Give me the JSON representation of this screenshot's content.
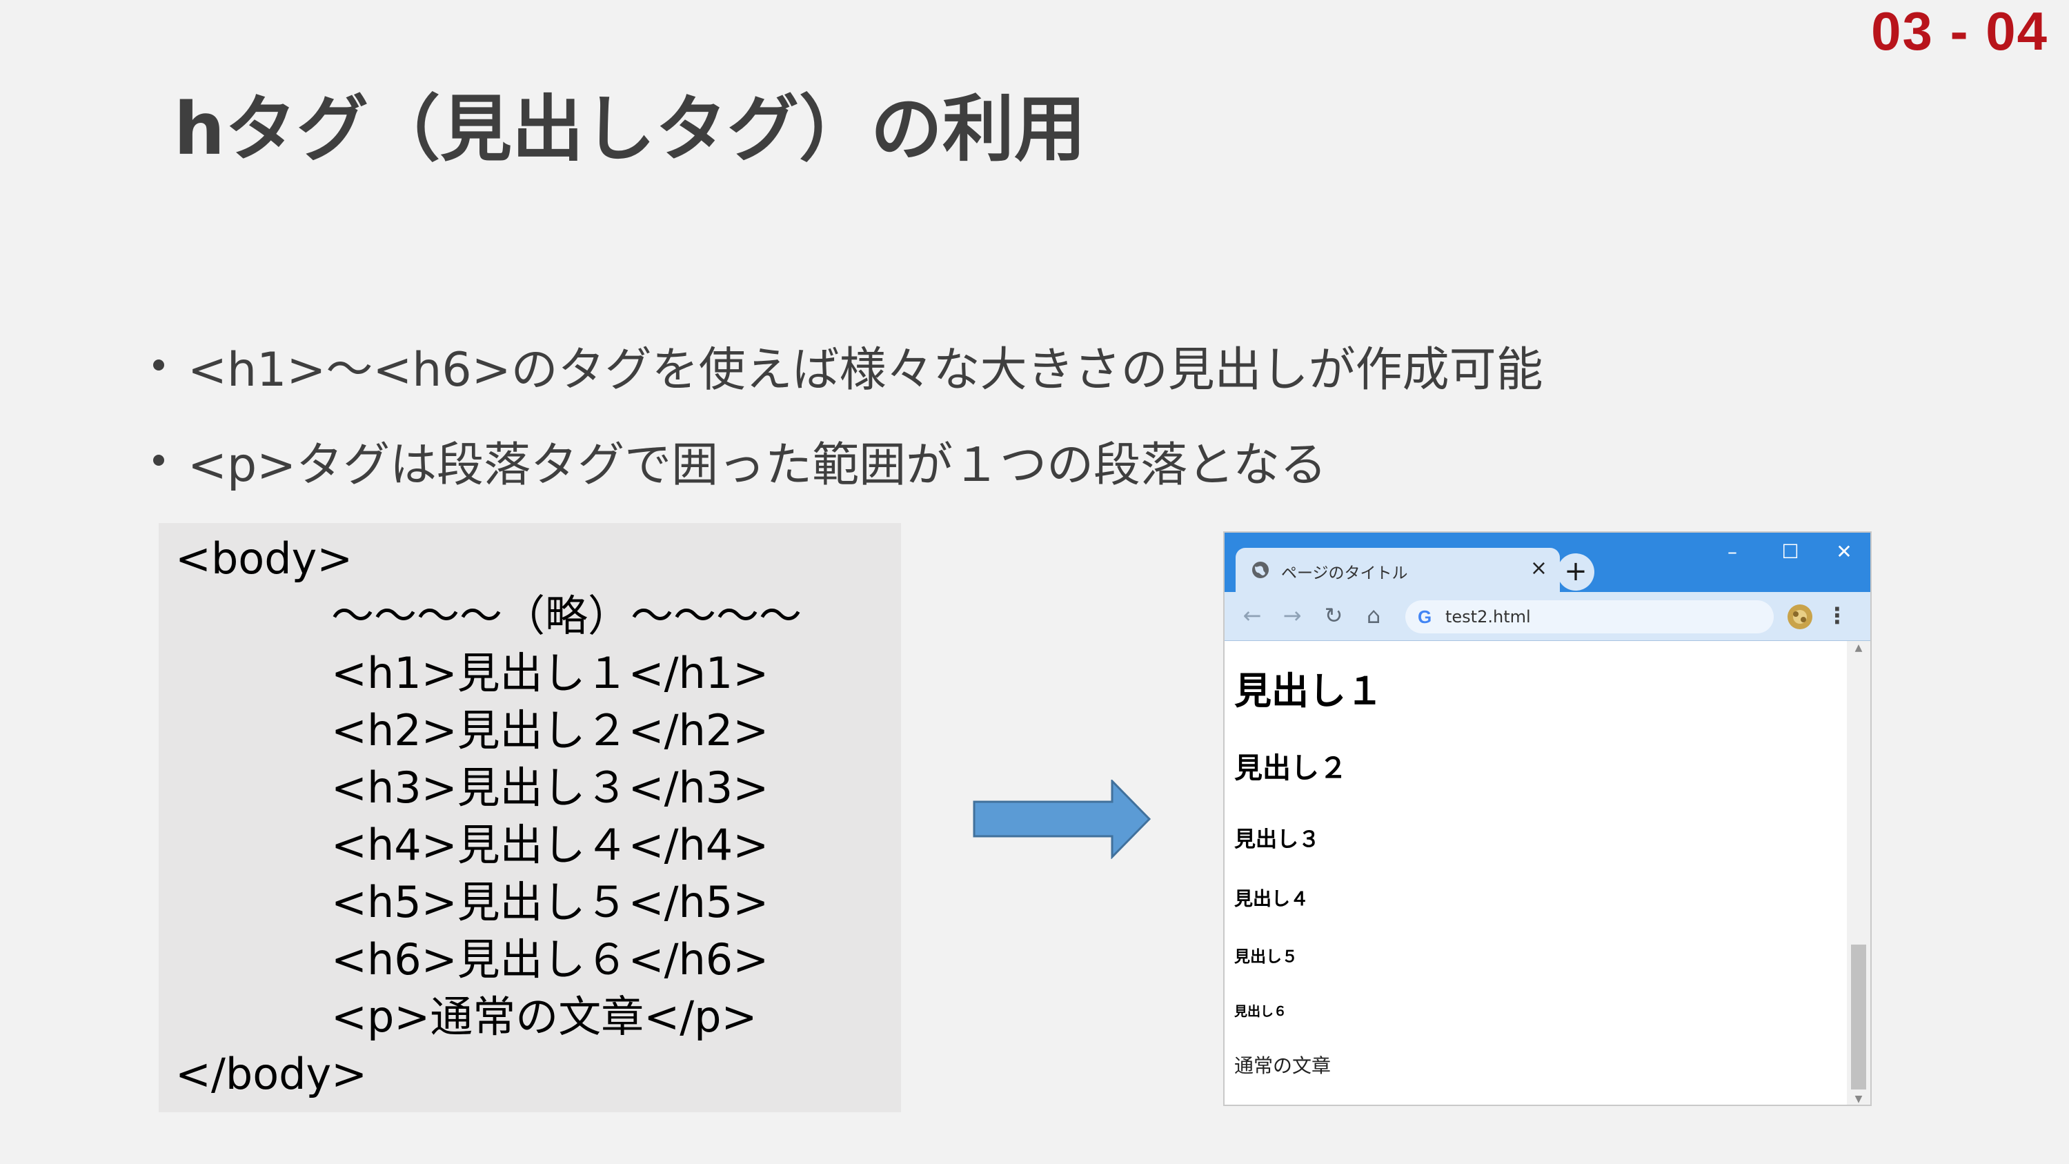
{
  "slide": {
    "page_number": "03 - 04",
    "title": "hタグ（見出しタグ）の利用",
    "bullets": [
      "<h1>〜<h6>のタグを使えば様々な大きさの見出しが作成可能",
      "<p>タグは段落タグで囲った範囲が１つの段落となる"
    ],
    "code_lines": [
      "<body>",
      "〜〜〜〜（略）〜〜〜〜",
      "<h1>見出し１</h1>",
      "<h2>見出し２</h2>",
      "<h3>見出し３</h3>",
      "<h4>見出し４</h4>",
      "<h5>見出し５</h5>",
      "<h6>見出し６</h6>",
      "<p>通常の文章</p>",
      "</body>"
    ]
  },
  "browser": {
    "tab_title": "ページのタイトル",
    "tab_close": "×",
    "new_tab": "+",
    "window_minimize": "–",
    "window_maximize": "☐",
    "window_close": "✕",
    "nav_back": "←",
    "nav_forward": "→",
    "nav_reload": "↻",
    "nav_home": "⌂",
    "address_icon": "G",
    "address": "test2.html",
    "menu": "⋮",
    "scroll_up": "▲",
    "scroll_down": "▼",
    "content": {
      "h1": "見出し１",
      "h2": "見出し２",
      "h3": "見出し３",
      "h4": "見出し４",
      "h5": "見出し５",
      "h6": "見出し６",
      "p": "通常の文章"
    }
  },
  "colors": {
    "background": "#f2f2f2",
    "title_text": "#3f3f3f",
    "page_number": "#b8141b",
    "code_background": "#e7e6e6",
    "arrow_fill": "#5b9bd5",
    "arrow_stroke": "#41719c",
    "browser_titlebar": "#2f88e0",
    "browser_toolbar": "#d7e7f8"
  },
  "icons": {
    "arrow": "right-arrow-icon",
    "tab_favicon": "globe-icon",
    "extension": "extension-icon"
  }
}
